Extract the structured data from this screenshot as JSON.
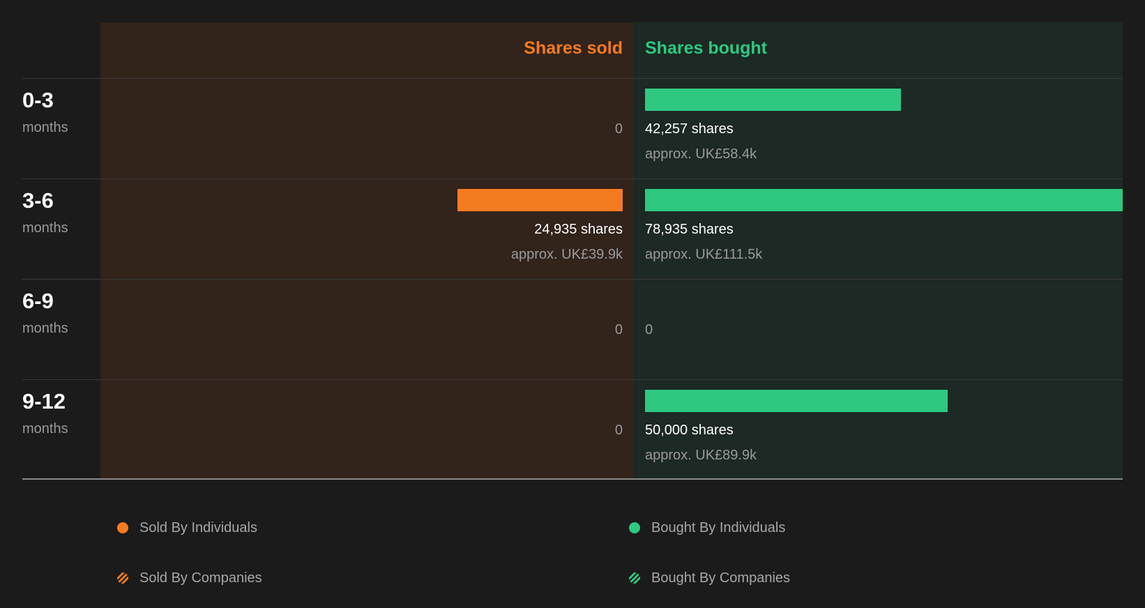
{
  "colors": {
    "sold": "#f57b20",
    "bought": "#2ec881",
    "sold_panel": "#32231b",
    "bought_panel": "#1c2924"
  },
  "chart_data": {
    "type": "bar",
    "orientation": "horizontal-diverging",
    "headers": {
      "sold": "Shares sold",
      "bought": "Shares bought"
    },
    "rows": [
      {
        "period": "0-3",
        "unit": "months",
        "sold": 0,
        "sold_text": "0",
        "sold_approx": "",
        "bought": 42257,
        "bought_text": "42,257 shares",
        "bought_approx": "approx. UK£58.4k"
      },
      {
        "period": "3-6",
        "unit": "months",
        "sold": 24935,
        "sold_text": "24,935 shares",
        "sold_approx": "approx. UK£39.9k",
        "bought": 78935,
        "bought_text": "78,935 shares",
        "bought_approx": "approx. UK£111.5k"
      },
      {
        "period": "6-9",
        "unit": "months",
        "sold": 0,
        "sold_text": "0",
        "sold_approx": "",
        "bought": 0,
        "bought_text": "0",
        "bought_approx": ""
      },
      {
        "period": "9-12",
        "unit": "months",
        "sold": 0,
        "sold_text": "0",
        "sold_approx": "",
        "bought": 50000,
        "bought_text": "50,000 shares",
        "bought_approx": "approx. UK£89.9k"
      }
    ],
    "max_value": 78935,
    "legend": [
      {
        "label": "Sold By Individuals",
        "color": "#f57b20",
        "pattern": "solid"
      },
      {
        "label": "Bought By Individuals",
        "color": "#2ec881",
        "pattern": "solid"
      },
      {
        "label": "Sold By Companies",
        "color": "#f57b20",
        "pattern": "striped"
      },
      {
        "label": "Bought By Companies",
        "color": "#2ec881",
        "pattern": "striped"
      }
    ]
  }
}
